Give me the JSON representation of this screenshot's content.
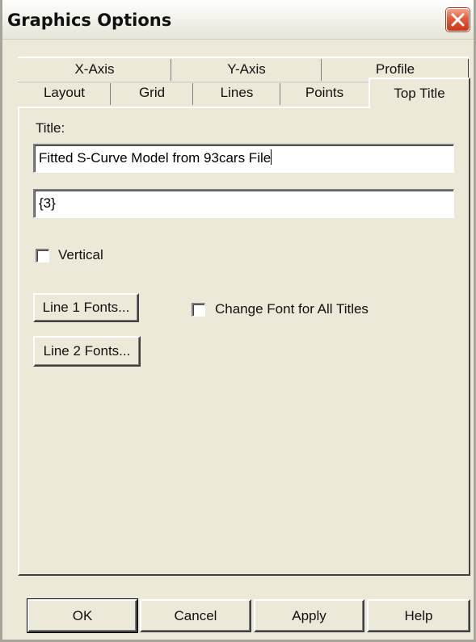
{
  "window": {
    "title": "Graphics Options"
  },
  "tabs": {
    "row1": [
      "X-Axis",
      "Y-Axis",
      "Profile"
    ],
    "row2": [
      "Layout",
      "Grid",
      "Lines",
      "Points"
    ],
    "active": "Top Title"
  },
  "top_title": {
    "title_label": "Title:",
    "line1_value": "Fitted S-Curve Model from 93cars File",
    "line2_value": "{3}",
    "vertical_label": "Vertical",
    "vertical_checked": false,
    "line1_fonts_button": "Line 1 Fonts...",
    "line2_fonts_button": "Line 2 Fonts...",
    "change_font_all_label": "Change Font for All Titles",
    "change_font_all_checked": false
  },
  "buttons": {
    "ok": "OK",
    "cancel": "Cancel",
    "apply": "Apply",
    "help": "Help"
  },
  "icons": {
    "close": "close-icon"
  },
  "colors": {
    "dialog_bg": "#ece9d8",
    "close_button": "#e3593a"
  }
}
